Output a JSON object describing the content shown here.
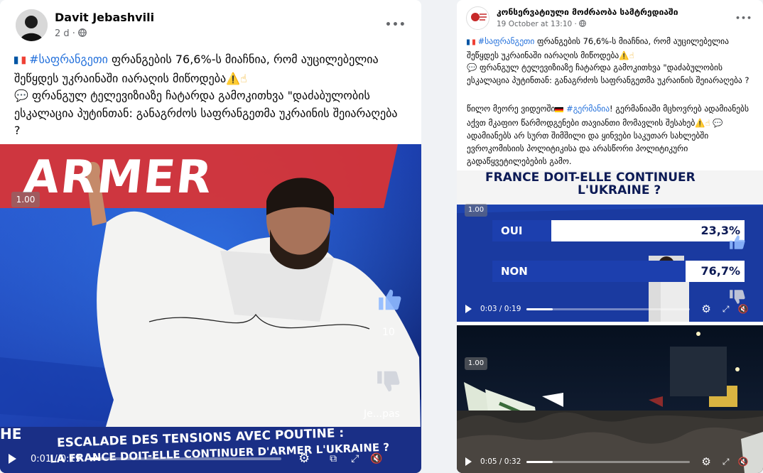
{
  "left_post": {
    "author": "Davit Jebashvili",
    "time": "2 d ·",
    "more": "•••",
    "text_tag": "#საფრანგეთი",
    "text_1": " ფრანგების 76,6%-ს მიაჩნია, რომ აუცილებელია შეწყდეს უკრაინაში იარაღის მიწოდება",
    "text_2": " ფრანგულ ტელევიზიაზე ჩატარდა გამოკითხვა \"დაძაბულობის ესკალაცია პუტინთან: განაგრძოს საფრანგეთმა უკრაინის შეიარაღება ?",
    "video": {
      "badge": "1.00",
      "time": "0:01 / 0:19",
      "progress": 0.05,
      "banner_line1": "ESCALADE DES TENSIONS AVEC POUTINE :",
      "banner_line2": "LA FRANCE DOIT-ELLE CONTINUER D'ARMER L'UKRAINE ?",
      "bg_text": "ARMER",
      "like_count": "10",
      "dislike_label": "Je...pas",
      "corner_label": "HE"
    }
  },
  "right_post": {
    "author": "კონსერვატიული მოძრაობა სამტრედიაში",
    "time": "19 October at 13:10 ·",
    "more": "•••",
    "text_tag": "#საფრანგეთი",
    "text_1": " ფრანგების 76,6%-ს მიაჩნია, რომ აუცილებელია შეწყდეს უკრაინაში იარაღის მიწოდება",
    "text_2": " ფრანგულ ტელევიზიაზე ჩატარდა გამოკითხვა \"დაძაბულობის ესკალაცია პუტინთან: განაგრძოს საფრანგეთმა უკრაინის შეიარაღება ?",
    "text2_a": "წილო მეორე ვიდეოში",
    "text2_tag": "#გერმანია",
    "text2_b": "! გერმანიაში მცხოვრებ ადამიანებს აქვთ მკაფიო წარმოდგენები თავიანთი მომავლის შესახებ",
    "text2_c": " ადამიანებს არ სურთ შიმშილი და ყინვები საკუთარ სახლებში ევროკომისიის პოლიტიკისა და არასწორი პოლიტიკური გადაწყვეტილებების გამო.",
    "video1": {
      "badge": "1.00",
      "time": "0:03 / 0:19",
      "progress": 0.16,
      "header_line1": "FRANCE DOIT-ELLE CONTINUER",
      "header_line2": "L'UKRAINE ?",
      "oui_label": "OUI",
      "oui_value": "23,3%",
      "non_label": "NON",
      "non_value": "76,7%",
      "oui_pct": 23.3,
      "non_pct": 76.7
    },
    "video2": {
      "badge": "1.00",
      "time": "0:05 / 0:32",
      "progress": 0.16
    }
  },
  "colors": {
    "link": "#216fdb",
    "tv_blue": "#1b3d9c",
    "tv_dark": "#0c1a55"
  }
}
